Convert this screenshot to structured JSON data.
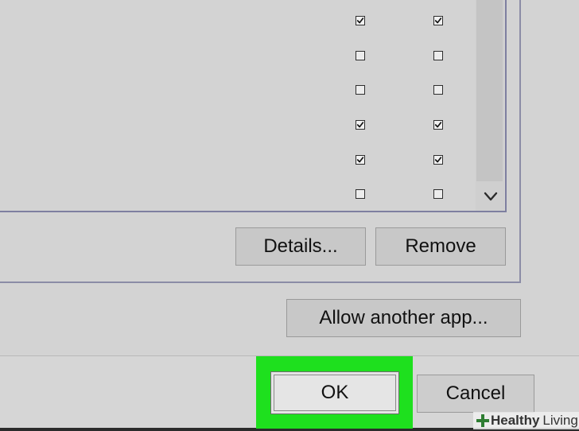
{
  "app_list": {
    "rows": [
      {
        "private_checked": true,
        "public_checked": true
      },
      {
        "private_checked": false,
        "public_checked": false
      },
      {
        "private_checked": false,
        "public_checked": false
      },
      {
        "private_checked": true,
        "public_checked": true
      },
      {
        "private_checked": true,
        "public_checked": true
      },
      {
        "private_checked": false,
        "public_checked": false
      }
    ],
    "scroll_down_icon": "chevron-down-icon"
  },
  "buttons": {
    "details_label": "Details...",
    "remove_label": "Remove",
    "allow_another_app_label": "Allow another app...",
    "ok_label": "OK",
    "cancel_label": "Cancel"
  },
  "highlight": {
    "color": "#1ee01e",
    "target": "ok-button"
  },
  "watermark": {
    "brand_bold": "Healthy",
    "brand_regular": "Living",
    "icon": "plus-cross-icon",
    "icon_color": "#2e7d32"
  }
}
